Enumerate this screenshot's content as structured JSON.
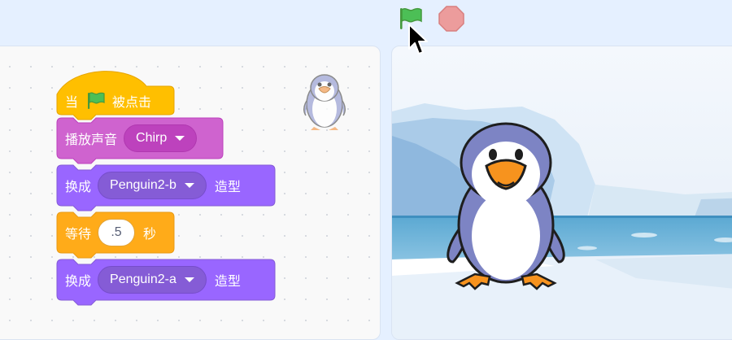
{
  "colors": {
    "events": "#ffbf00",
    "events_border": "#e6a400",
    "sound": "#cf63cf",
    "sound_pill": "#bd42bd",
    "looks": "#9966ff",
    "looks_pill": "#855cd6",
    "control": "#ffab19",
    "control_border": "#e89a15",
    "green_flag": "#4cbf56",
    "stop": "#ec9c9c"
  },
  "toolbar": {
    "green_flag_icon": "green-flag-icon",
    "stop_icon": "stop-icon"
  },
  "script": {
    "hat_block": {
      "prefix": "当",
      "icon": "green-flag-icon",
      "suffix": "被点击"
    },
    "play_sound_block": {
      "label": "播放声音",
      "sound_value": "Chirp"
    },
    "switch_costume_block_1": {
      "label": "换成",
      "costume_value": "Penguin2-b",
      "suffix": "造型"
    },
    "wait_block": {
      "label": "等待",
      "seconds_value": ".5",
      "suffix": "秒"
    },
    "switch_costume_block_2": {
      "label": "换成",
      "costume_value": "Penguin2-a",
      "suffix": "造型"
    }
  },
  "sprite": {
    "icon": "penguin-sprite-icon"
  },
  "stage": {
    "backdrop": "arctic-backdrop",
    "character": "penguin-sprite"
  }
}
